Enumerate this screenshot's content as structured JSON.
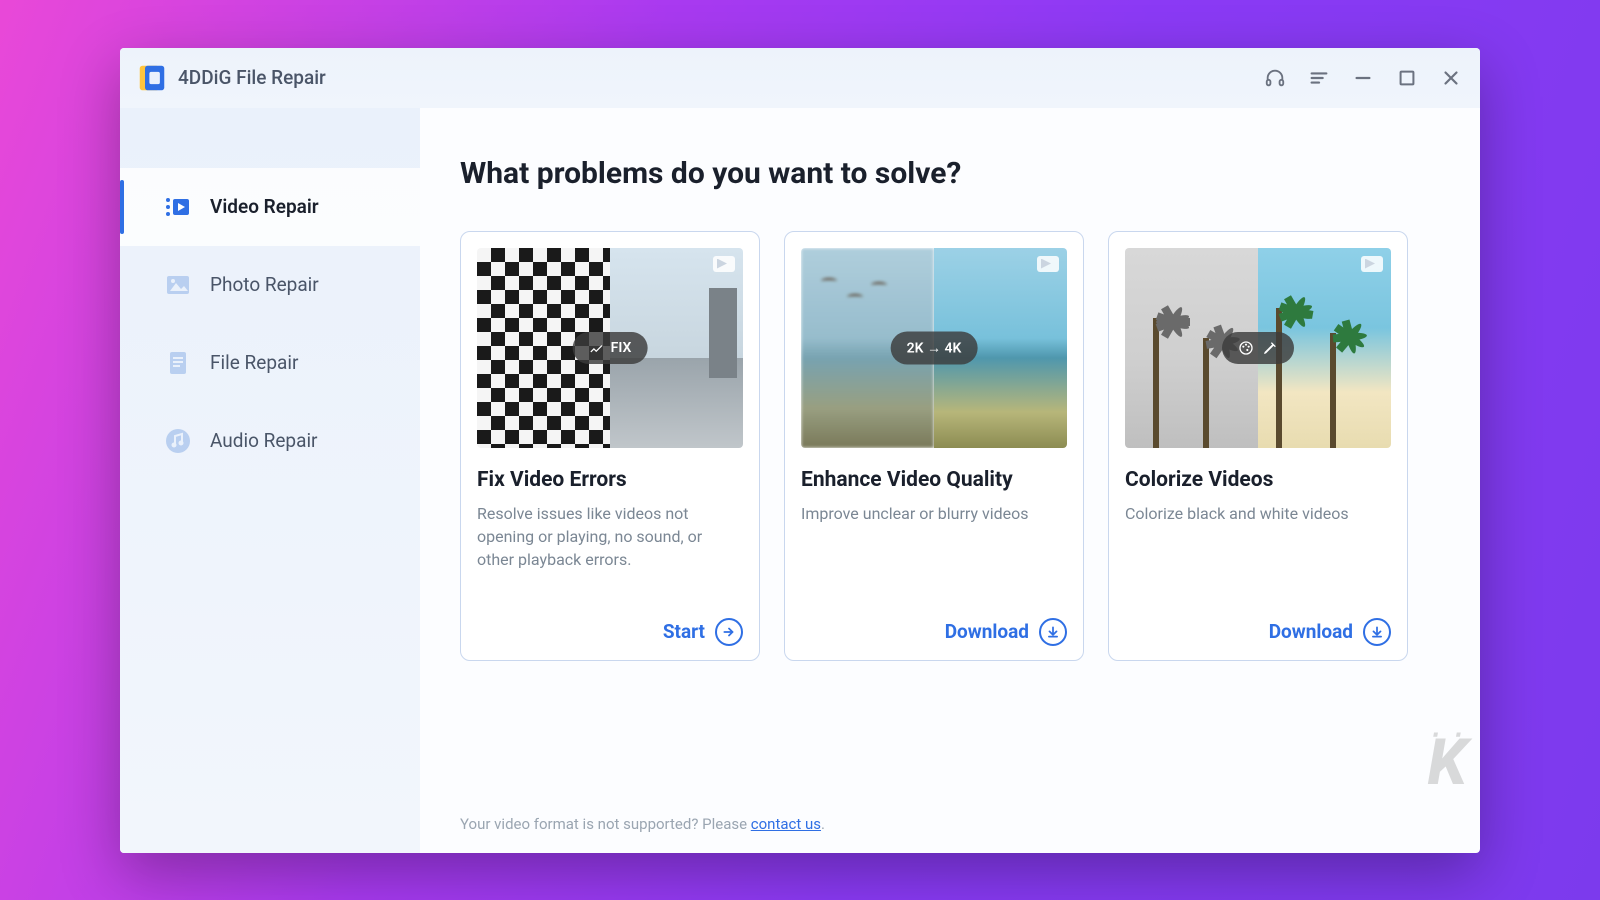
{
  "app": {
    "title": "4DDiG File Repair"
  },
  "sidebar": {
    "items": [
      {
        "label": "Video Repair",
        "icon": "video-repair-icon",
        "active": true
      },
      {
        "label": "Photo Repair",
        "icon": "photo-repair-icon",
        "active": false
      },
      {
        "label": "File Repair",
        "icon": "file-repair-icon",
        "active": false
      },
      {
        "label": "Audio Repair",
        "icon": "audio-repair-icon",
        "active": false
      }
    ]
  },
  "main": {
    "heading": "What problems do you want to solve?",
    "cards": [
      {
        "badge": "FIX",
        "title": "Fix Video Errors",
        "desc": "Resolve issues like videos not opening or playing, no sound, or other playback errors.",
        "action_label": "Start",
        "action_icon": "arrow-right-icon"
      },
      {
        "badge": "2K → 4K",
        "title": "Enhance Video Quality",
        "desc": "Improve unclear or blurry videos",
        "action_label": "Download",
        "action_icon": "download-icon"
      },
      {
        "badge": "",
        "title": "Colorize Videos",
        "desc": "Colorize black and white videos",
        "action_label": "Download",
        "action_icon": "download-icon"
      }
    ],
    "footer": {
      "text_before": "Your video format is not supported? Please ",
      "link": "contact us",
      "text_after": "."
    }
  },
  "titlebar_icons": [
    "headset-icon",
    "menu-icon",
    "minimize-icon",
    "maximize-icon",
    "close-icon"
  ],
  "colors": {
    "accent": "#2f6fe4",
    "text": "#1a202c",
    "muted": "#7b8794"
  },
  "watermark": "K"
}
